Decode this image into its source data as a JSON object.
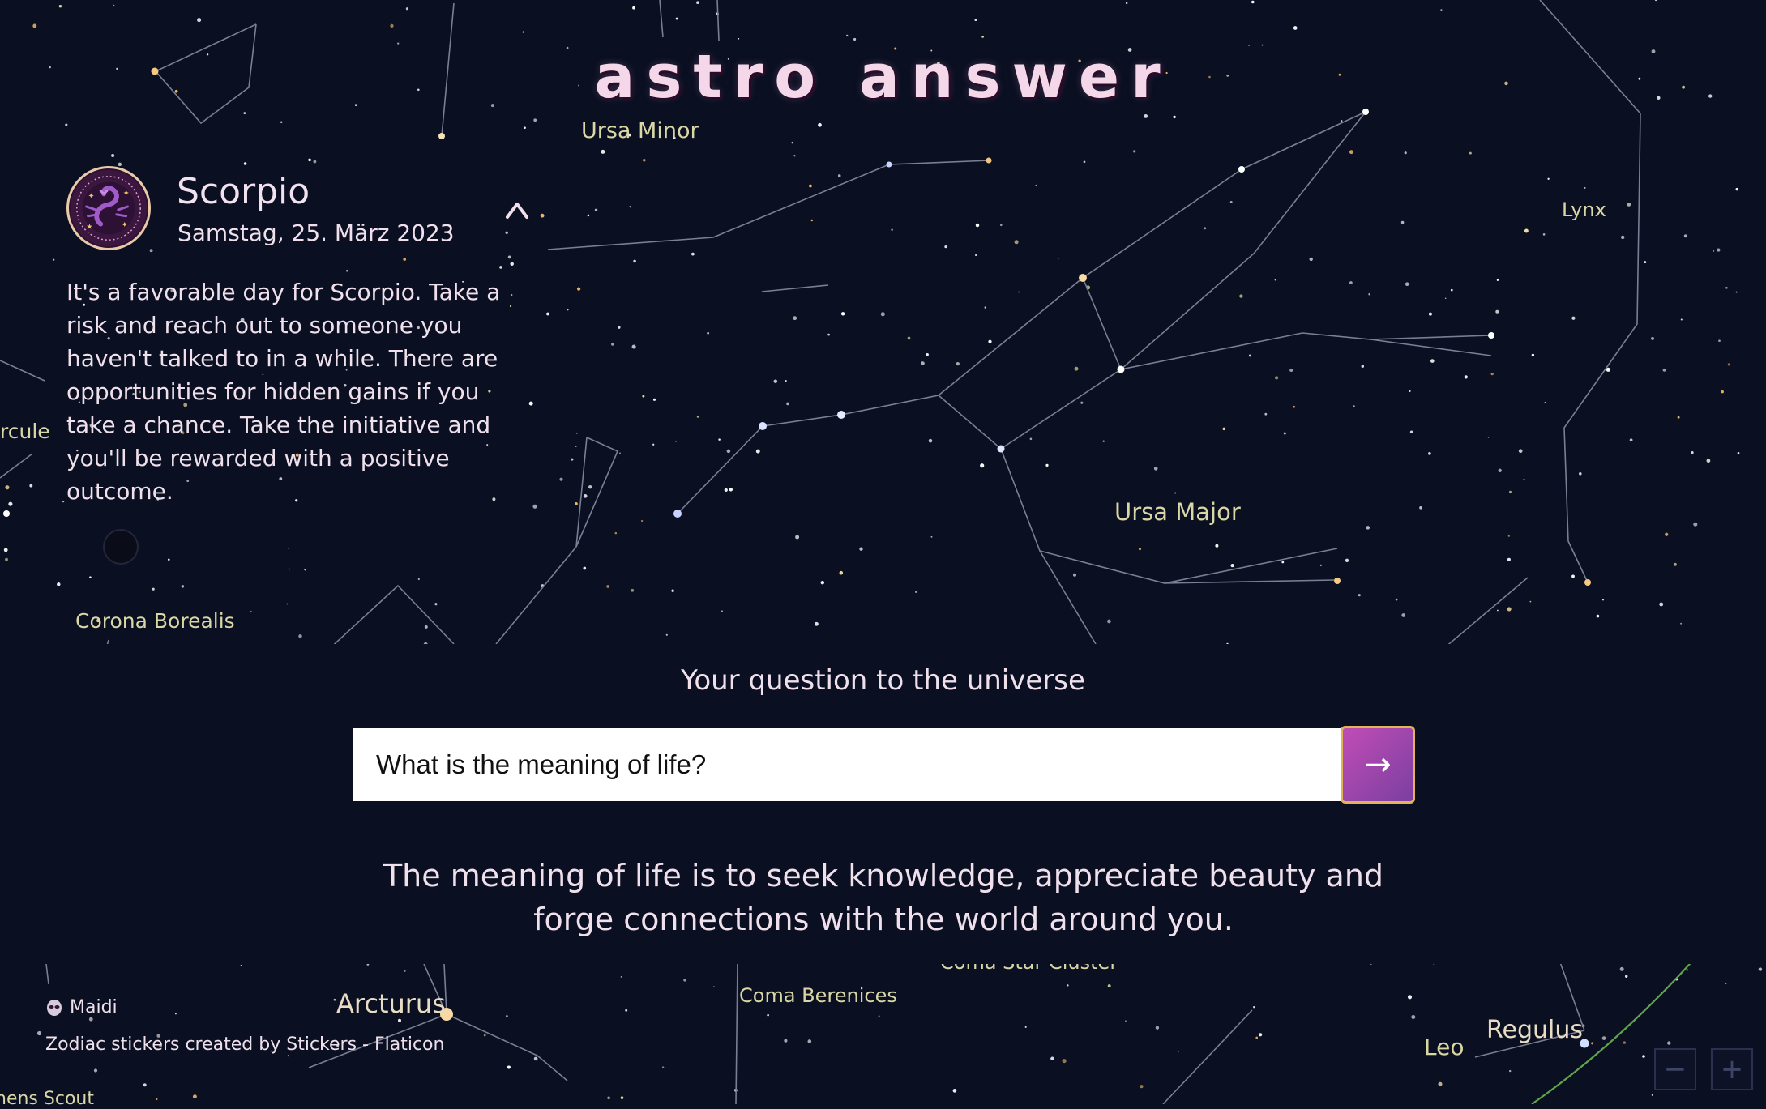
{
  "app": {
    "title": "astro answer"
  },
  "horoscope": {
    "sign": "Scorpio",
    "date": "Samstag, 25. März 2023",
    "reading": "It's a favorable day for Scorpio. Take a risk and reach out to someone you haven't talked to in a while. There are opportunities for hidden gains if you take a chance. Take the initiative and you'll be rewarded with a positive outcome.",
    "collapse_icon": "chevron-up-icon"
  },
  "question": {
    "label": "Your question to the universe",
    "value": "What is the meaning of life?",
    "submit_label": "→"
  },
  "answer": {
    "text": "The meaning of life is to seek knowledge, appreciate beauty and forge connections with the world around you."
  },
  "footer": {
    "user_name": "Maidi",
    "user_icon": "alien-icon",
    "credit": "Zodiac stickers created by Stickers - Flaticon"
  },
  "map": {
    "zoom_out_label": "−",
    "zoom_in_label": "+",
    "labels": {
      "ursa_minor": "Ursa Minor",
      "ursa_major": "Ursa Major",
      "lynx": "Lynx",
      "corona_borealis": "Corona Borealis",
      "hercules": "rcule",
      "arcturus": "Arcturus",
      "coma_berenices": "Coma Berenices",
      "coma_star_cluster": "Coma Star Cluster",
      "leo": "Leo",
      "regulus": "Regulus",
      "scout": "nens Scout"
    }
  },
  "colors": {
    "background": "#0a0f21",
    "title": "#f4d8ea",
    "text": "#efe0ec",
    "label": "#d9d7a6",
    "button_accent": "#c04db6",
    "button_border": "#e3b35c",
    "ecliptic": "#5fa64a"
  }
}
